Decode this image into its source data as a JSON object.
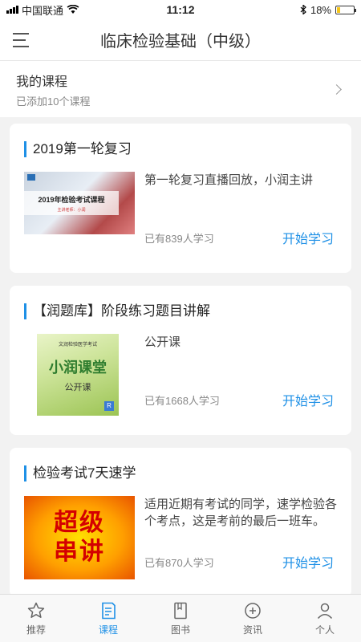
{
  "status": {
    "carrier": "中国联通",
    "time": "11:12",
    "battery": "18%",
    "battery_level": 0.18
  },
  "header": {
    "title": "临床检验基础（中级）"
  },
  "my_courses": {
    "title": "我的课程",
    "subtitle": "已添加10个课程"
  },
  "courses": [
    {
      "title": "2019第一轮复习",
      "description": "第一轮复习直播回放，小润主讲",
      "learners": "已有839人学习",
      "action": "开始学习",
      "thumb": {
        "line1": "2019年检验考试课程",
        "line2": "主讲老师：小润"
      }
    },
    {
      "title": "【润题库】阶段练习题目讲解",
      "description": "公开课",
      "learners": "已有1668人学习",
      "action": "开始学习",
      "thumb": {
        "line1": "文润检验医学考试",
        "line2": "小润课堂",
        "line3": "公开课",
        "badge": "R"
      }
    },
    {
      "title": "检验考试7天速学",
      "description": "适用近期有考试的同学，速学检验各个考点，这是考前的最后一班车。",
      "learners": "已有870人学习",
      "action": "开始学习",
      "thumb": {
        "line1": "超级",
        "line2": "串讲"
      }
    }
  ],
  "tabbar": [
    {
      "label": "推荐",
      "icon": "star-icon",
      "active": false
    },
    {
      "label": "课程",
      "icon": "course-doc-icon",
      "active": true
    },
    {
      "label": "图书",
      "icon": "book-icon",
      "active": false
    },
    {
      "label": "资讯",
      "icon": "news-icon",
      "active": false
    },
    {
      "label": "个人",
      "icon": "person-icon",
      "active": false
    }
  ],
  "colors": {
    "accent": "#1e90e6",
    "background": "#f2f2f2"
  }
}
